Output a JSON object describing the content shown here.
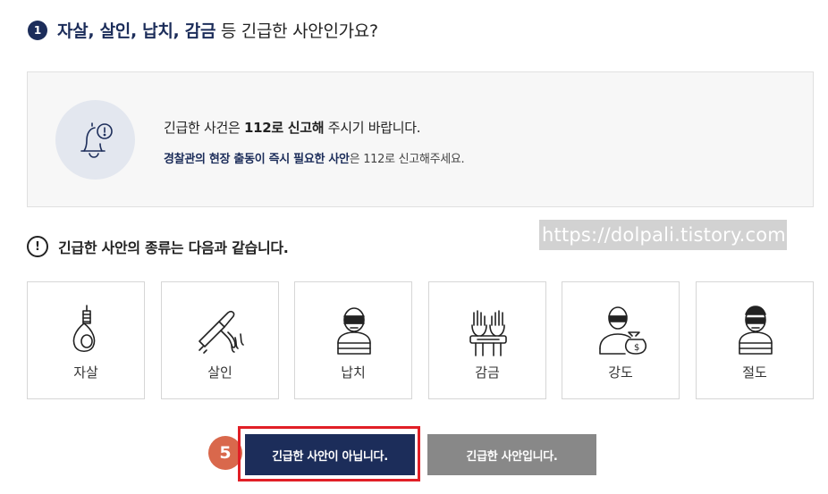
{
  "question": {
    "number": "1",
    "bold_text": "자살, 살인, 납치, 감금",
    "rest_text": " 등 긴급한 사안인가요?"
  },
  "notice": {
    "line1_prefix": "긴급한 사건은 ",
    "line1_bold": "112로 신고해",
    "line1_suffix": " 주시기 바랍니다.",
    "line2_bold": "경찰관의 현장 출동이 즉시 필요한 사안",
    "line2_rest": "은 112로 신고해주세요.",
    "icon": "bell-alert-icon"
  },
  "watermark": "https://dolpali.tistory.com",
  "types": {
    "icon_text": "!",
    "title": "긴급한 사안의 종류는 다음과 같습니다.",
    "items": [
      {
        "label": "자살",
        "icon": "noose-icon"
      },
      {
        "label": "살인",
        "icon": "knife-icon"
      },
      {
        "label": "납치",
        "icon": "kidnap-icon"
      },
      {
        "label": "감금",
        "icon": "bound-hands-icon"
      },
      {
        "label": "강도",
        "icon": "robber-icon"
      },
      {
        "label": "절도",
        "icon": "thief-icon"
      }
    ]
  },
  "step_badge": "5",
  "buttons": {
    "not_urgent": "긴급한 사안이 아닙니다.",
    "urgent": "긴급한 사안입니다."
  },
  "colors": {
    "navy": "#1c2d5a",
    "gray_button": "#888888",
    "highlight_red": "#e11f26",
    "badge_orange": "#d9684c"
  }
}
